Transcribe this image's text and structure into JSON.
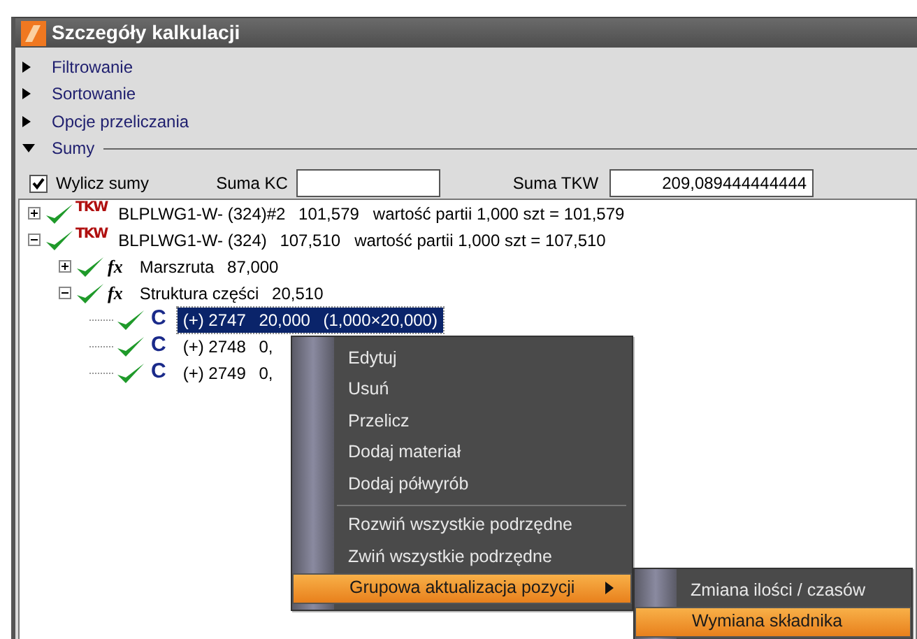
{
  "window": {
    "title": "Szczegóły kalkulacji"
  },
  "sections": [
    {
      "label": "Filtrowanie",
      "expanded": false
    },
    {
      "label": "Sortowanie",
      "expanded": false
    },
    {
      "label": "Opcje przeliczania",
      "expanded": false
    },
    {
      "label": "Sumy",
      "expanded": true
    }
  ],
  "sums": {
    "checkbox": {
      "label": "Wylicz sumy",
      "checked": true
    },
    "kc": {
      "label": "Suma KC"
    },
    "tkw": {
      "label": "Suma TKW",
      "value": "209,089444444444"
    }
  },
  "tree": [
    {
      "kind": "tkw",
      "badge": "TKW",
      "name": "BLPLWG1-W- (324)#2",
      "value": "101,579",
      "detail": "wartość partii 1,000 szt = 101,579",
      "expanded": false,
      "selected": false
    },
    {
      "kind": "tkw",
      "badge": "TKW",
      "name": "BLPLWG1-W- (324)",
      "value": "107,510",
      "detail": "wartość partii 1,000 szt = 107,510",
      "expanded": true,
      "selected": false,
      "children": [
        {
          "kind": "fx",
          "badge": "fx",
          "name": "Marszruta",
          "value": "87,000",
          "expanded": false,
          "selected": false
        },
        {
          "kind": "fx",
          "badge": "fx",
          "name": "Struktura części",
          "value": "20,510",
          "expanded": true,
          "selected": false,
          "children": [
            {
              "kind": "c",
              "badge": "C",
              "name": "(+) 2747",
              "value": "20,000",
              "detail": "(1,000×20,000)",
              "selected": true
            },
            {
              "kind": "c",
              "badge": "C",
              "name": "(+) 2748",
              "value": "0,",
              "selected": false
            },
            {
              "kind": "c",
              "badge": "C",
              "name": "(+) 2749",
              "value": "0,",
              "selected": false
            }
          ]
        }
      ]
    }
  ],
  "context_menu": {
    "items": [
      {
        "kind": "item",
        "label": "Edytuj",
        "highlighted": false
      },
      {
        "kind": "item",
        "label": "Usuń",
        "highlighted": false
      },
      {
        "kind": "item",
        "label": "Przelicz",
        "highlighted": false
      },
      {
        "kind": "item",
        "label": "Dodaj materiał",
        "highlighted": false
      },
      {
        "kind": "item",
        "label": "Dodaj półwyrób",
        "highlighted": false
      },
      {
        "kind": "separator"
      },
      {
        "kind": "item",
        "label": "Rozwiń wszystkie podrzędne",
        "highlighted": false
      },
      {
        "kind": "item",
        "label": "Zwiń wszystkie podrzędne",
        "highlighted": false
      },
      {
        "kind": "submenu",
        "label": "Grupowa aktualizacja pozycji",
        "highlighted": true,
        "items": [
          {
            "label": "Zmiana ilości / czasów",
            "highlighted": false
          },
          {
            "label": "Wymiana składnika",
            "highlighted": true
          }
        ]
      }
    ]
  }
}
